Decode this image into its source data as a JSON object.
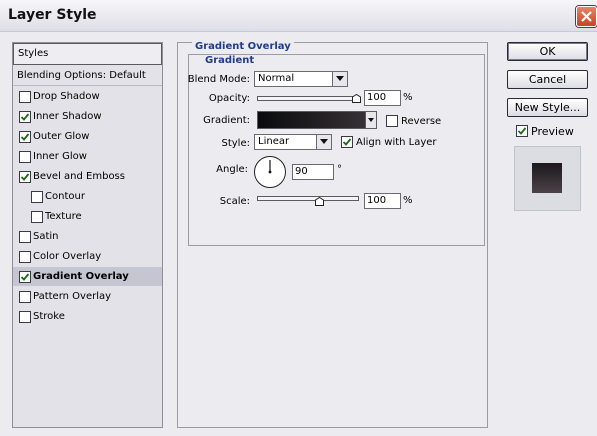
{
  "window": {
    "title": "Layer Style"
  },
  "styles_panel": {
    "header": "Styles",
    "blending_options": "Blending Options: Default",
    "items": [
      {
        "label": "Drop Shadow",
        "checked": false,
        "selected": false,
        "indent": false
      },
      {
        "label": "Inner Shadow",
        "checked": true,
        "selected": false,
        "indent": false
      },
      {
        "label": "Outer Glow",
        "checked": true,
        "selected": false,
        "indent": false
      },
      {
        "label": "Inner Glow",
        "checked": false,
        "selected": false,
        "indent": false
      },
      {
        "label": "Bevel and Emboss",
        "checked": true,
        "selected": false,
        "indent": false
      },
      {
        "label": "Contour",
        "checked": false,
        "selected": false,
        "indent": true
      },
      {
        "label": "Texture",
        "checked": false,
        "selected": false,
        "indent": true
      },
      {
        "label": "Satin",
        "checked": false,
        "selected": false,
        "indent": false
      },
      {
        "label": "Color Overlay",
        "checked": false,
        "selected": false,
        "indent": false
      },
      {
        "label": "Gradient Overlay",
        "checked": true,
        "selected": true,
        "indent": false
      },
      {
        "label": "Pattern Overlay",
        "checked": false,
        "selected": false,
        "indent": false
      },
      {
        "label": "Stroke",
        "checked": false,
        "selected": false,
        "indent": false
      }
    ]
  },
  "gradient_overlay": {
    "section_title": "Gradient Overlay",
    "group_title": "Gradient",
    "blend_mode_label": "Blend Mode:",
    "blend_mode_value": "Normal",
    "opacity_label": "Opacity:",
    "opacity_value": "100",
    "opacity_unit": "%",
    "gradient_label": "Gradient:",
    "reverse_label": "Reverse",
    "reverse_checked": false,
    "style_label": "Style:",
    "style_value": "Linear",
    "align_label": "Align with Layer",
    "align_checked": true,
    "angle_label": "Angle:",
    "angle_value": "90",
    "angle_unit": "°",
    "scale_label": "Scale:",
    "scale_value": "100",
    "scale_unit": "%"
  },
  "buttons": {
    "ok": "OK",
    "cancel": "Cancel",
    "new_style": "New Style...",
    "preview_label": "Preview",
    "preview_checked": true
  },
  "icons": [
    "close-icon",
    "checkmark-icon",
    "dropdown-arrow-icon",
    "slider-thumb-icon",
    "angle-dial-icon"
  ]
}
